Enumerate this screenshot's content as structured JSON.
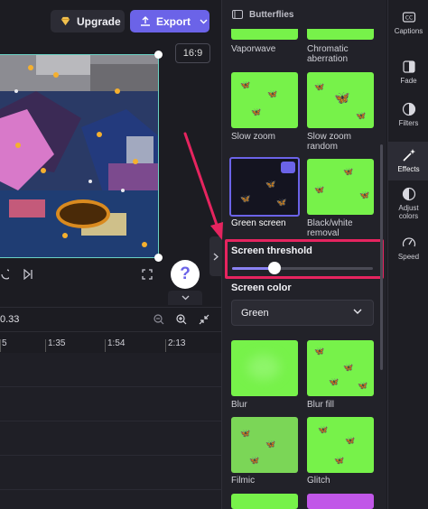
{
  "header": {
    "upgrade_label": "Upgrade",
    "export_label": "Export"
  },
  "preview": {
    "aspect_ratio": "16:9",
    "help_label": "?"
  },
  "timeline": {
    "current_time": "0.33",
    "ticks": [
      "5",
      "1:35",
      "1:54",
      "2:13"
    ]
  },
  "panel": {
    "title": "Butterflies",
    "effects": [
      {
        "label": "Vaporwave"
      },
      {
        "label": "Chromatic aberration"
      },
      {
        "label": "Slow zoom"
      },
      {
        "label": "Slow zoom random"
      },
      {
        "label": "Green screen",
        "selected": true
      },
      {
        "label": "Black/white removal"
      },
      {
        "label": "Blur"
      },
      {
        "label": "Blur fill"
      },
      {
        "label": "Filmic"
      },
      {
        "label": "Glitch"
      }
    ],
    "threshold": {
      "label": "Screen threshold",
      "value": 0.3
    },
    "screen_color": {
      "label": "Screen color",
      "selected": "Green"
    }
  },
  "rail": {
    "items": [
      {
        "label": "Captions",
        "icon": "captions-icon"
      },
      {
        "label": "Fade",
        "icon": "fade-icon"
      },
      {
        "label": "Filters",
        "icon": "filters-icon"
      },
      {
        "label": "Effects",
        "icon": "effects-icon",
        "active": true
      },
      {
        "label": "Adjust colors",
        "icon": "adjust-colors-icon"
      },
      {
        "label": "Speed",
        "icon": "speed-icon"
      }
    ]
  },
  "colors": {
    "accent": "#6b63e8",
    "highlight": "#e6245f",
    "green_screen": "#77f24a"
  }
}
